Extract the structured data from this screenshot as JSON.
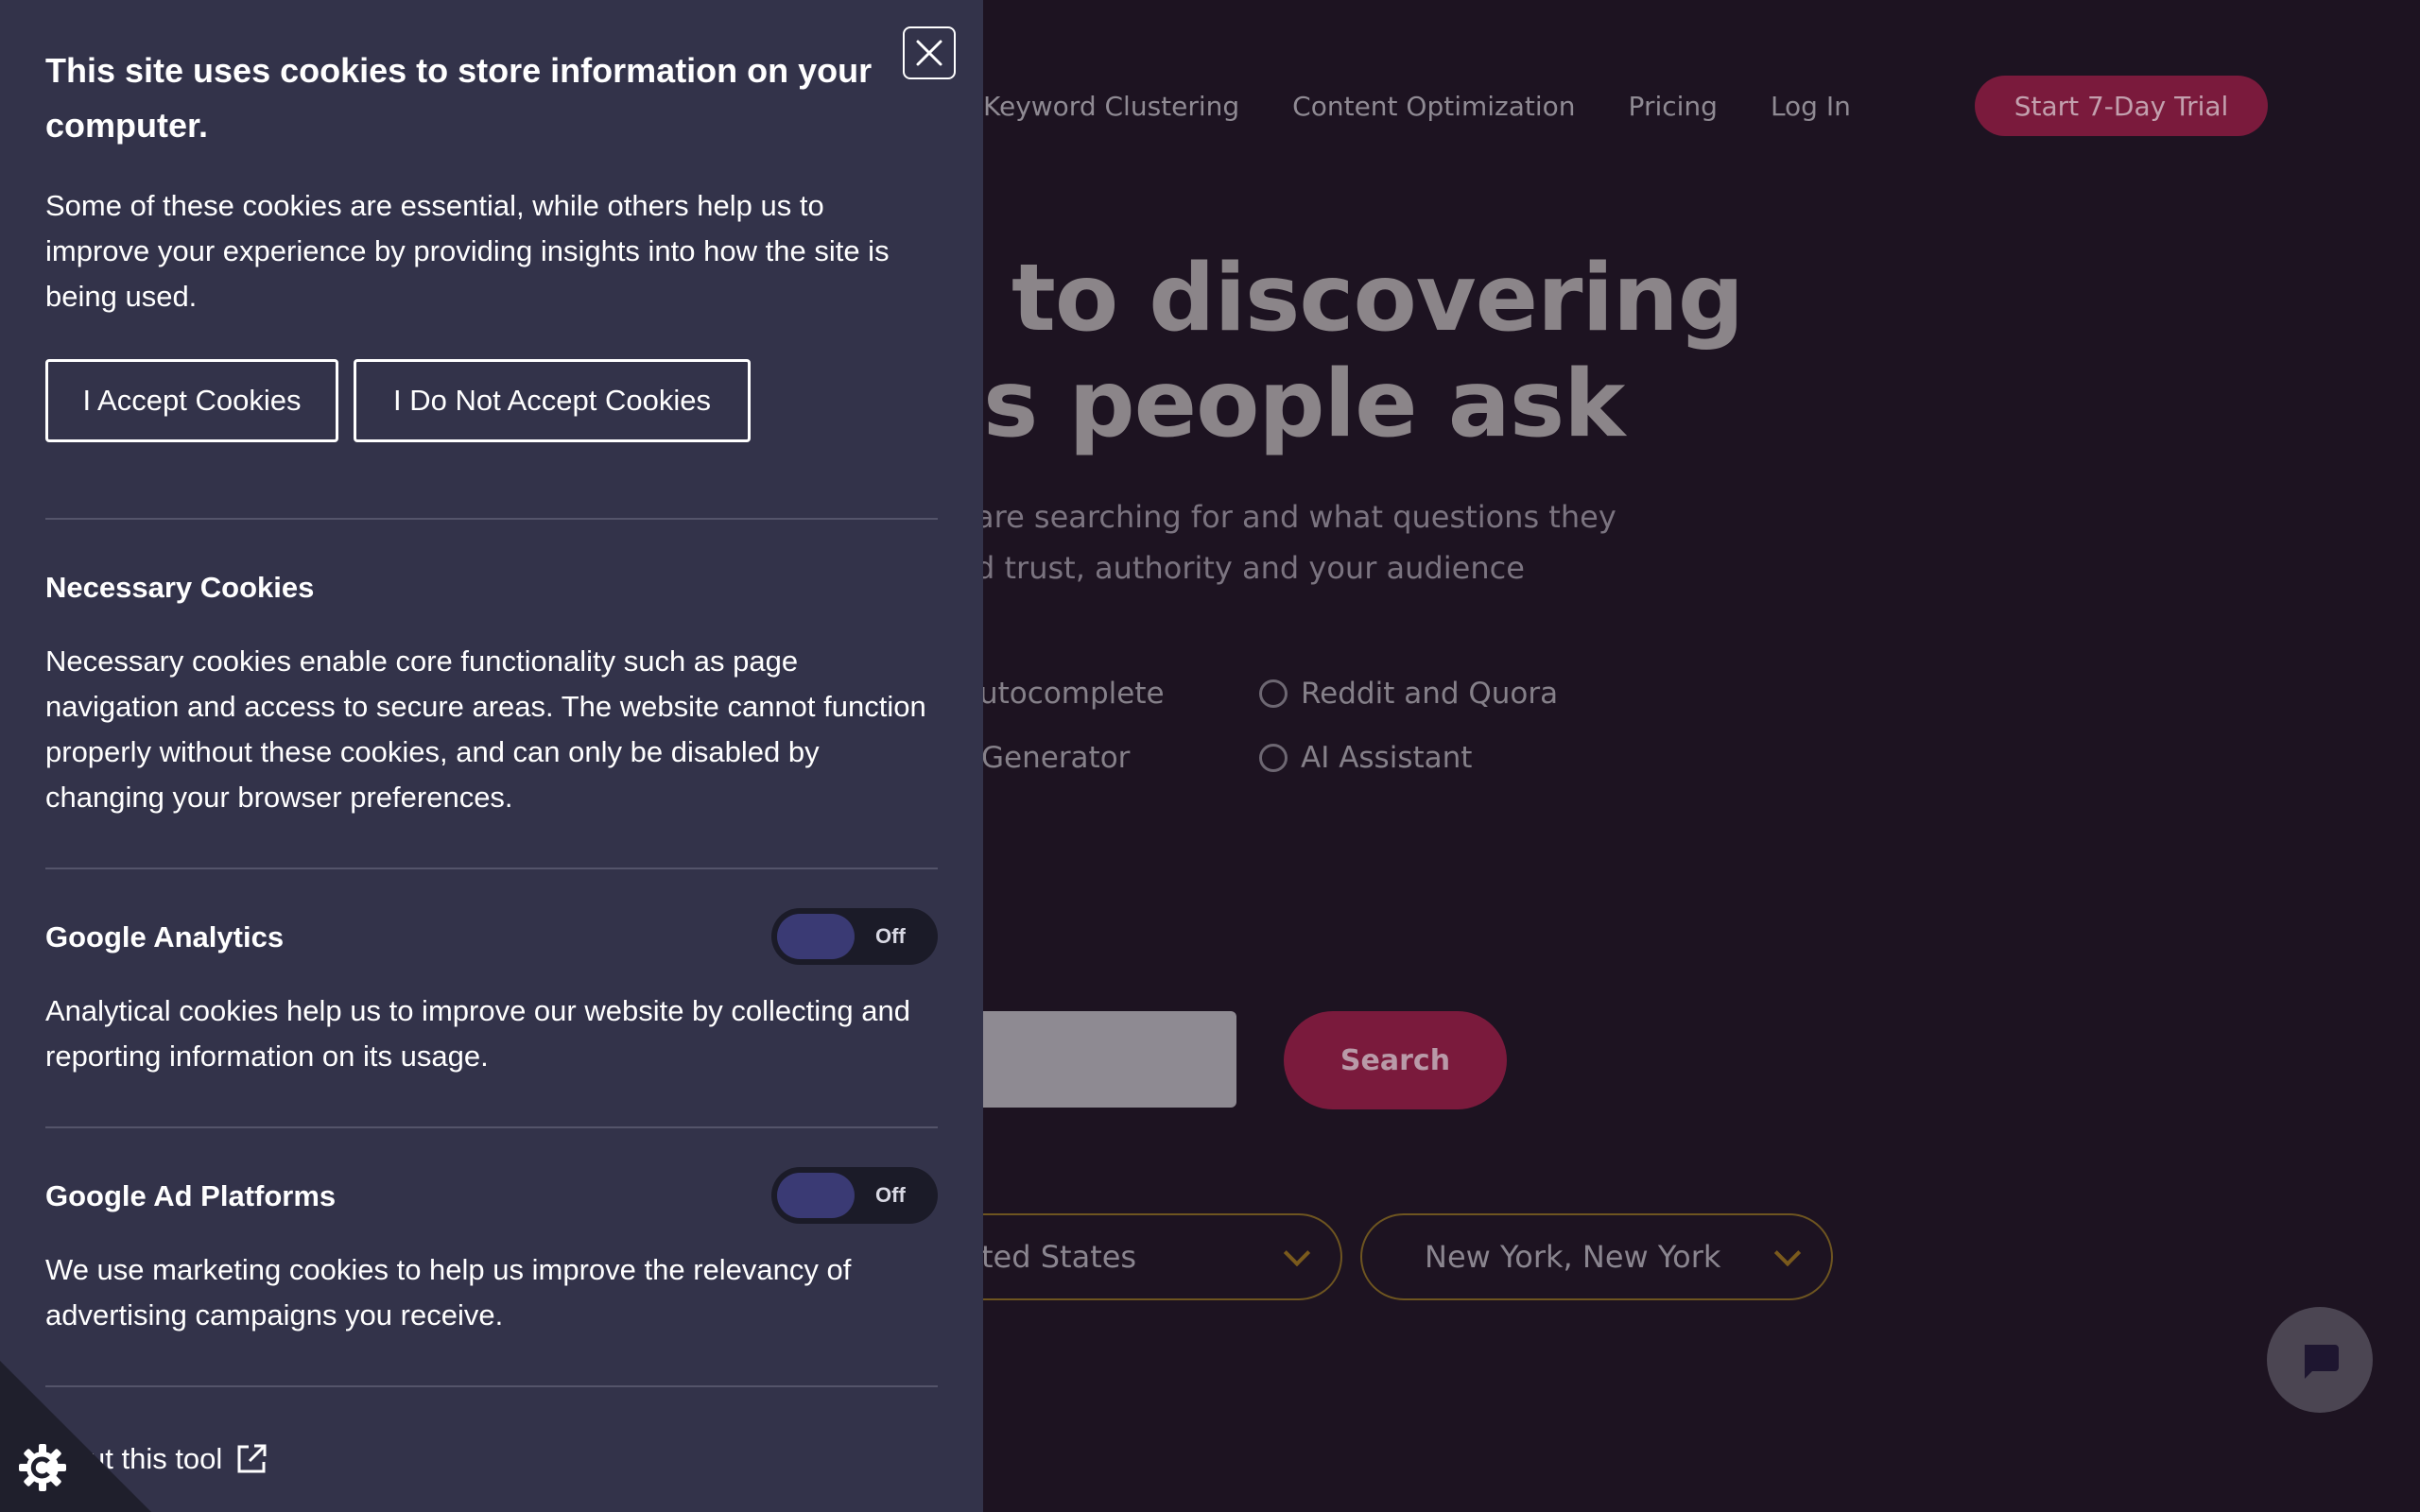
{
  "nav": {
    "items": [
      "Keyword Clustering",
      "Content Optimization",
      "Pricing",
      "Log In"
    ],
    "trial_button": "Start 7-Day Trial"
  },
  "hero": {
    "line1": "to discovering",
    "line2": "s people ask",
    "subtitle_line1": "are searching for and what questions they",
    "subtitle_line2": "d trust, authority and your audience"
  },
  "options": {
    "autocomplete": "utocomplete",
    "generator": "Generator",
    "reddit": "Reddit and Quora",
    "ai": "AI Assistant"
  },
  "search": {
    "button_label": "Search"
  },
  "selects": {
    "country": "ted States",
    "city": "New York, New York"
  },
  "cookie": {
    "title": "This site uses cookies to store information on your computer.",
    "intro": "Some of these cookies are essential, while others help us to improve your experience by providing insights into how the site is being used.",
    "accept_label": "I Accept Cookies",
    "decline_label": "I Do Not Accept Cookies",
    "necessary": {
      "title": "Necessary Cookies",
      "text": "Necessary cookies enable core functionality such as page navigation and access to secure areas. The website cannot function properly without these cookies, and can only be disabled by changing your browser preferences."
    },
    "analytics": {
      "title": "Google Analytics",
      "toggle": "Off",
      "text": "Analytical cookies help us to improve our website by collecting and reporting information on its usage."
    },
    "ads": {
      "title": "Google Ad Platforms",
      "toggle": "Off",
      "text": "We use marketing cookies to help us improve the relevancy of advertising campaigns you receive."
    },
    "about_label": "ut this tool"
  },
  "colors": {
    "panel_bg": "#33334a",
    "page_bg": "#1d1321",
    "accent": "#7a1a3c",
    "select_border": "#6e5520"
  },
  "icons": [
    "close-icon",
    "external-link-icon",
    "cookie-settings-gear-icon",
    "chat-bubble-icon",
    "chevron-down-icon"
  ]
}
